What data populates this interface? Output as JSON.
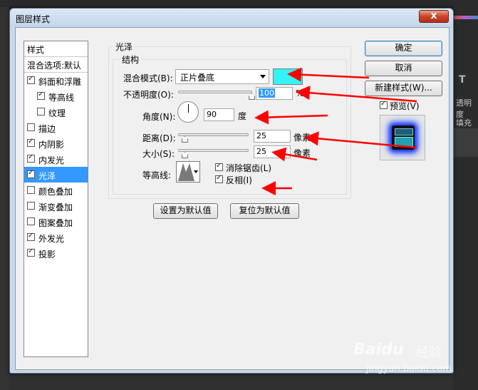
{
  "window_title": "图层样式",
  "close_glyph": "x",
  "styles_panel": {
    "header": "样式",
    "blend_options": "混合选项:默认",
    "items": [
      {
        "label": "斜面和浮雕",
        "checked": true,
        "sub": false,
        "selected": false
      },
      {
        "label": "等高线",
        "checked": true,
        "sub": true,
        "selected": false
      },
      {
        "label": "纹理",
        "checked": false,
        "sub": true,
        "selected": false
      },
      {
        "label": "描边",
        "checked": false,
        "sub": false,
        "selected": false
      },
      {
        "label": "内阴影",
        "checked": true,
        "sub": false,
        "selected": false
      },
      {
        "label": "内发光",
        "checked": true,
        "sub": false,
        "selected": false
      },
      {
        "label": "光泽",
        "checked": true,
        "sub": false,
        "selected": true
      },
      {
        "label": "颜色叠加",
        "checked": false,
        "sub": false,
        "selected": false
      },
      {
        "label": "渐变叠加",
        "checked": false,
        "sub": false,
        "selected": false
      },
      {
        "label": "图案叠加",
        "checked": false,
        "sub": false,
        "selected": false
      },
      {
        "label": "外发光",
        "checked": true,
        "sub": false,
        "selected": false
      },
      {
        "label": "投影",
        "checked": true,
        "sub": false,
        "selected": false
      }
    ]
  },
  "satin": {
    "section_title": "光泽",
    "structure_title": "结构",
    "blend_mode_label": "混合模式(B):",
    "blend_mode_value": "正片叠底",
    "blend_color": "#33f3f5",
    "opacity_label": "不透明度(O):",
    "opacity_value": "100",
    "opacity_fraction": 1.0,
    "opacity_unit": "%",
    "angle_label": "角度(N):",
    "angle_value": "90",
    "angle_unit": "度",
    "distance_label": "距离(D):",
    "distance_value": "25",
    "distance_fraction": 0.1,
    "distance_unit": "像素",
    "size_label": "大小(S):",
    "size_value": "25",
    "size_fraction": 0.1,
    "size_unit": "像素",
    "contour_label": "等高线:",
    "antialias_label": "消除锯齿(L)",
    "antialias_checked": true,
    "invert_label": "反相(I)",
    "invert_checked": true,
    "make_default": "设置为默认值",
    "reset_default": "复位为默认值"
  },
  "buttons": {
    "ok": "确定",
    "cancel": "取消",
    "new_style": "新建样式(W)...",
    "preview_label": "预览(V)",
    "preview_checked": true
  },
  "background": {
    "right_text_1": "T",
    "right_text_2": "透明度",
    "right_text_3": "填充"
  },
  "watermark": {
    "brand": "Baidu",
    "brand_cn": "经验",
    "url": "jingyan.baidu.com"
  },
  "annotation_color": "#ff0000"
}
